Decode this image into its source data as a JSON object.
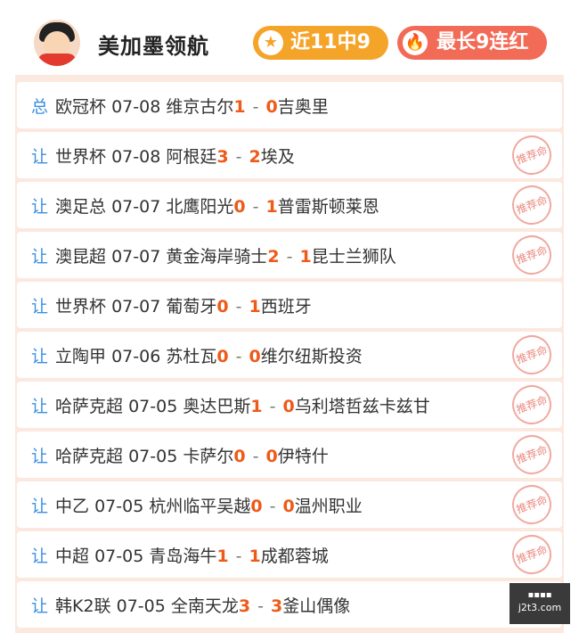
{
  "header": {
    "name": "美加墨领航",
    "badge_recent": {
      "label": "近11中9",
      "icon": "star-icon",
      "color": "#f5a42a"
    },
    "badge_streak": {
      "label": "最长9连红",
      "icon": "flame-icon",
      "color": "#f26b57"
    }
  },
  "rows": [
    {
      "tag": "总",
      "league": "欧冠杯",
      "date": "07-08",
      "home": "维京古尔",
      "home_score": "1",
      "away_score": "0",
      "away": "吉奥里",
      "stamp": false
    },
    {
      "tag": "让",
      "league": "世界杯",
      "date": "07-08",
      "home": "阿根廷",
      "home_score": "3",
      "away_score": "2",
      "away": "埃及",
      "stamp": true
    },
    {
      "tag": "让",
      "league": "澳足总",
      "date": "07-07",
      "home": "北鹰阳光",
      "home_score": "0",
      "away_score": "1",
      "away": "普雷斯顿莱恩",
      "stamp": true
    },
    {
      "tag": "让",
      "league": "澳昆超",
      "date": "07-07",
      "home": "黄金海岸骑士",
      "home_score": "2",
      "away_score": "1",
      "away": "昆士兰狮队",
      "stamp": true
    },
    {
      "tag": "让",
      "league": "世界杯",
      "date": "07-07",
      "home": "葡萄牙",
      "home_score": "0",
      "away_score": "1",
      "away": "西班牙",
      "stamp": false
    },
    {
      "tag": "让",
      "league": "立陶甲",
      "date": "07-06",
      "home": "苏杜瓦",
      "home_score": "0",
      "away_score": "0",
      "away": "维尔纽斯投资",
      "stamp": true
    },
    {
      "tag": "让",
      "league": "哈萨克超",
      "date": "07-05",
      "home": "奥达巴斯",
      "home_score": "1",
      "away_score": "0",
      "away": "乌利塔哲兹卡兹甘",
      "stamp": true
    },
    {
      "tag": "让",
      "league": "哈萨克超",
      "date": "07-05",
      "home": "卡萨尔",
      "home_score": "0",
      "away_score": "0",
      "away": "伊特什",
      "stamp": true
    },
    {
      "tag": "让",
      "league": "中乙",
      "date": "07-05",
      "home": "杭州临平吴越",
      "home_score": "0",
      "away_score": "0",
      "away": "温州职业",
      "stamp": true
    },
    {
      "tag": "让",
      "league": "中超",
      "date": "07-05",
      "home": "青岛海牛",
      "home_score": "1",
      "away_score": "1",
      "away": "成都蓉城",
      "stamp": true
    },
    {
      "tag": "让",
      "league": "韩K2联",
      "date": "07-05",
      "home": "全南天龙",
      "home_score": "3",
      "away_score": "3",
      "away": "釜山偶像",
      "stamp": false
    }
  ],
  "stamp_text": "推荐命中",
  "watermark": {
    "bottom": "j2t3.com"
  },
  "colors": {
    "tag": "#3a8fe0",
    "score": "#ee5a18",
    "panel_bg": "#fbe9df"
  }
}
